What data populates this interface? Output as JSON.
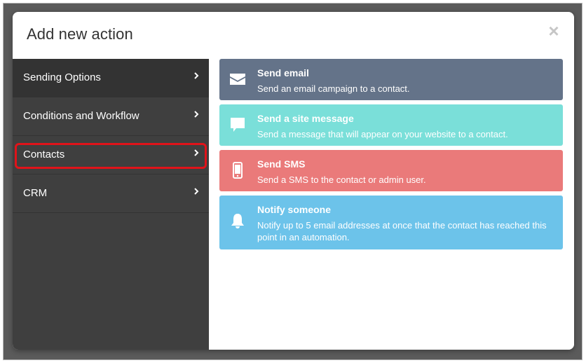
{
  "modal": {
    "title": "Add new action",
    "close_glyph": "×"
  },
  "sidebar": {
    "items": [
      {
        "label": "Sending Options",
        "active": true
      },
      {
        "label": "Conditions and Workflow",
        "active": false
      },
      {
        "label": "Contacts",
        "active": false,
        "highlighted": true
      },
      {
        "label": "CRM",
        "active": false
      }
    ],
    "chevron_icon": "chevron-right-icon"
  },
  "actions": [
    {
      "title": "Send email",
      "description": "Send an email campaign to a contact.",
      "icon": "envelope-icon",
      "color": "#647389"
    },
    {
      "title": "Send a site message",
      "description": "Send a message that will appear on your website to a contact.",
      "icon": "chat-bubble-icon",
      "color": "#7adfd9"
    },
    {
      "title": "Send SMS",
      "description": "Send a SMS to the contact or admin user.",
      "icon": "mobile-phone-icon",
      "color": "#ea7a7a"
    },
    {
      "title": "Notify someone",
      "description": "Notify up to 5 email addresses at once that the contact has reached this point in an automation.",
      "icon": "bell-icon",
      "color": "#6cc3ea"
    }
  ],
  "colors": {
    "sidebar_bg": "#3f3f3f",
    "sidebar_active_bg": "#333333",
    "highlight_border": "#e0131a"
  }
}
